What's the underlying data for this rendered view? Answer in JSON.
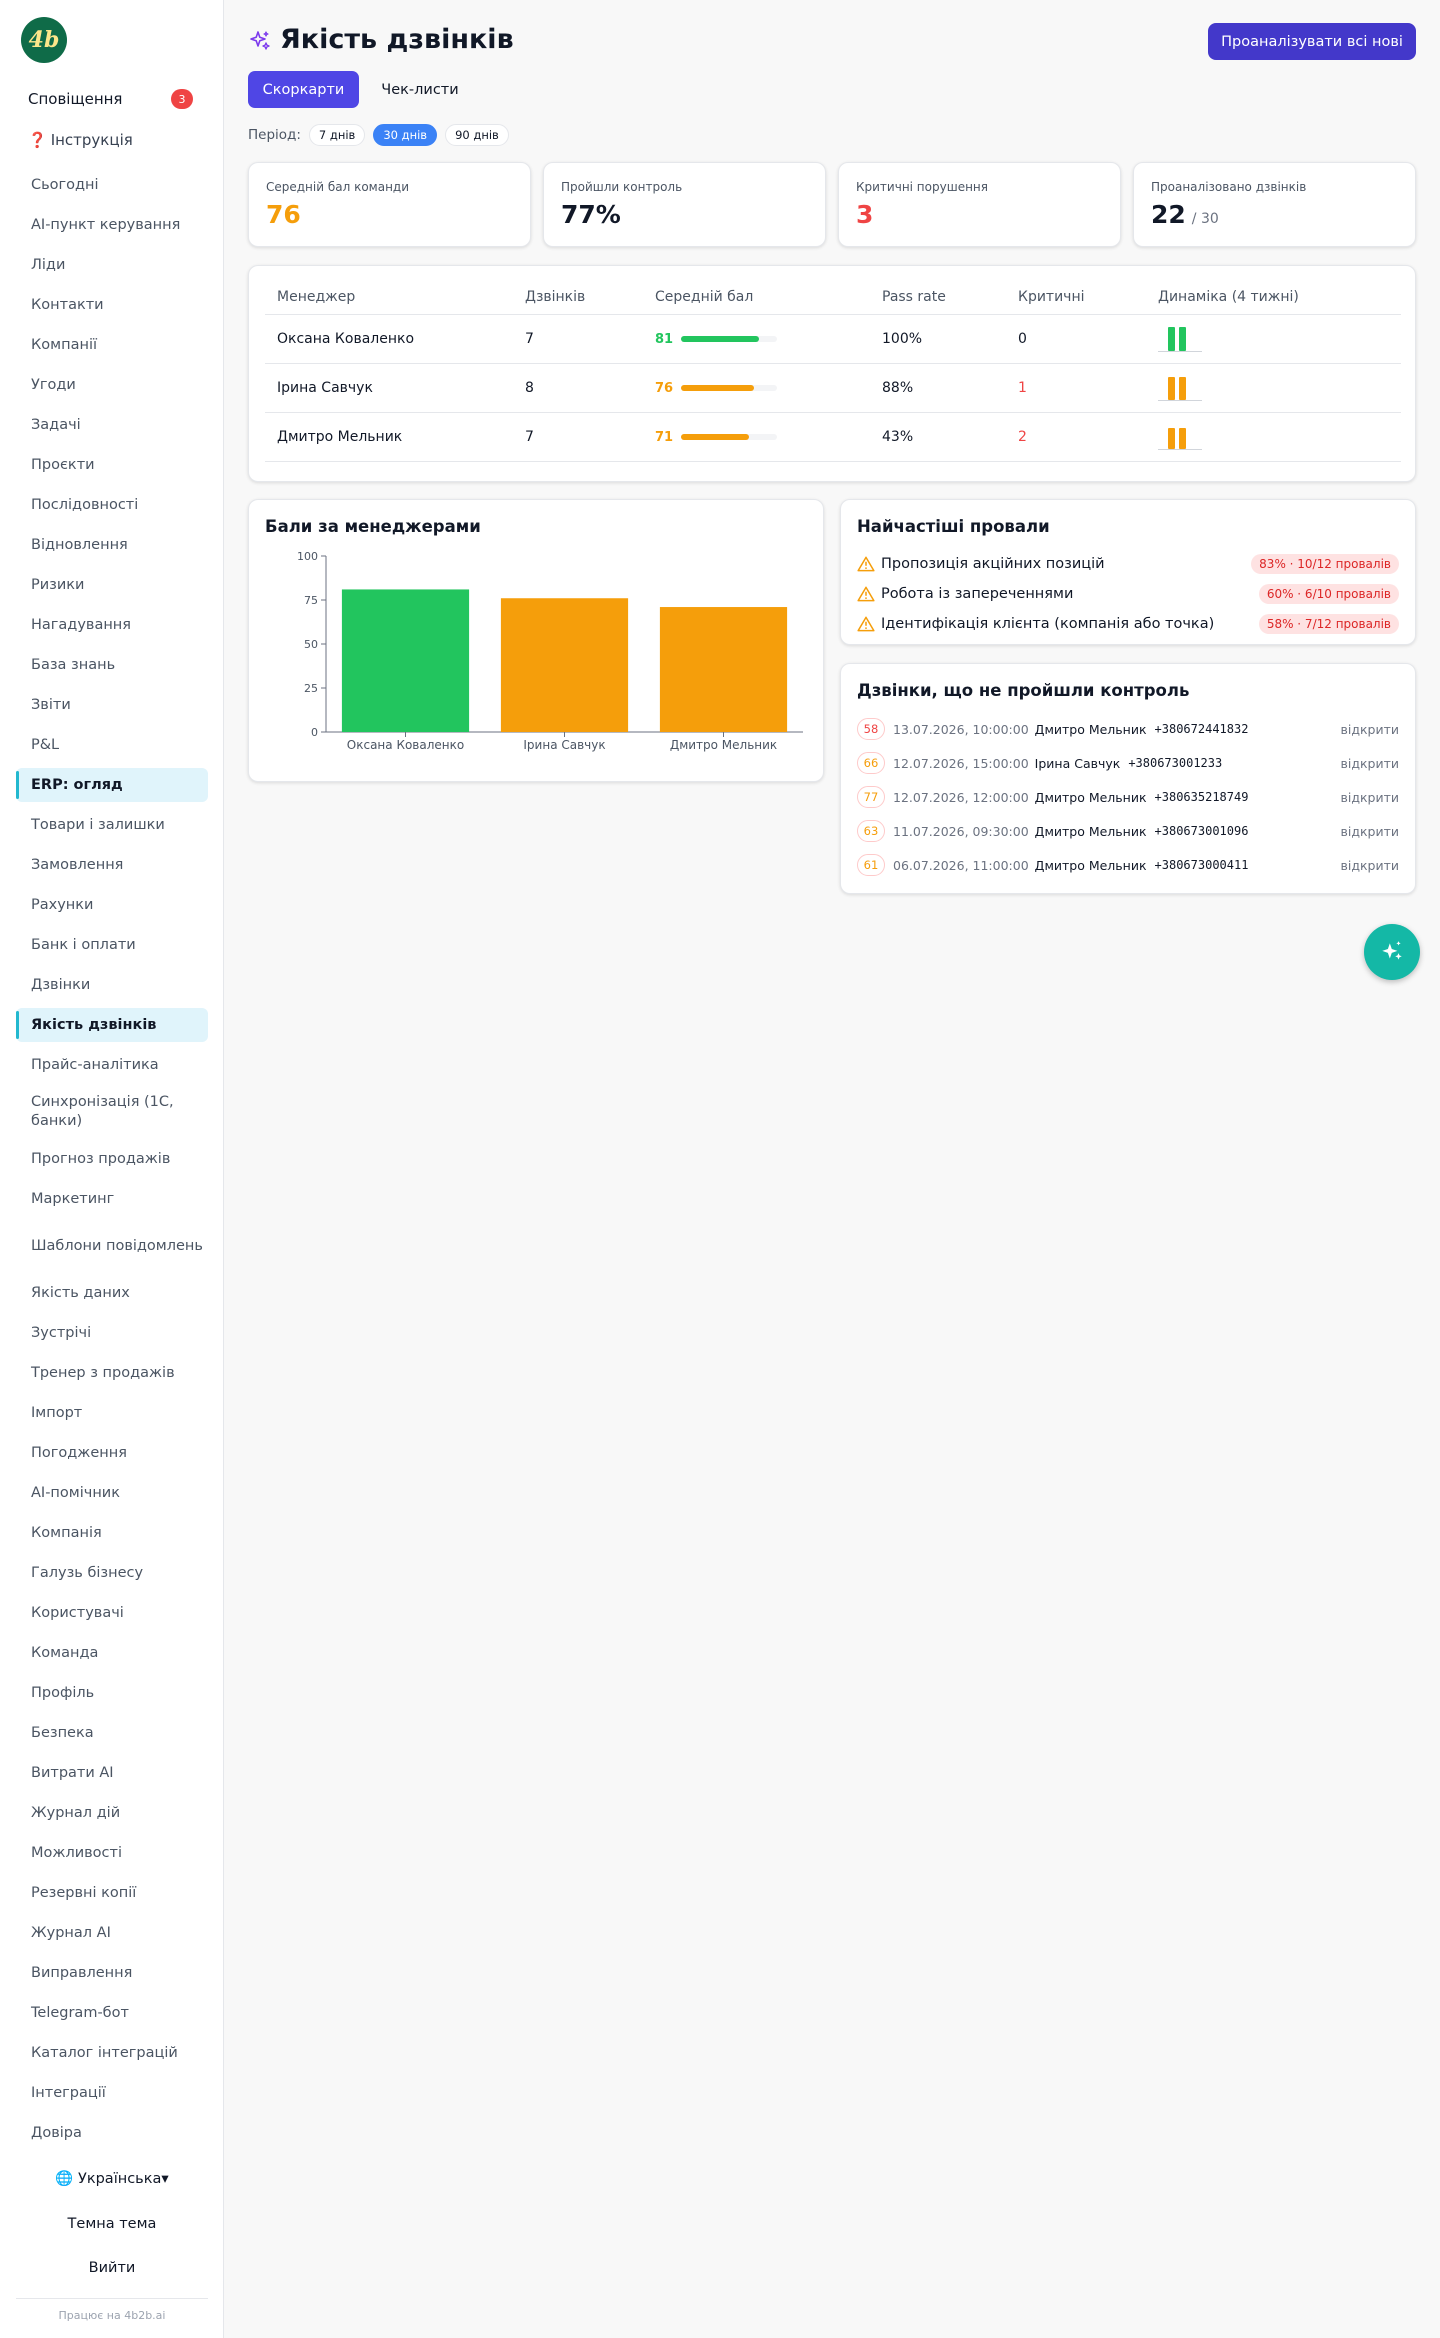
{
  "brand": {
    "logo_text": "4b"
  },
  "sidebar": {
    "notifications_label": "Сповіщення",
    "notifications_count": "3",
    "guide_icon": "❓",
    "guide_label": "Інструкція",
    "items": [
      {
        "label": "Сьогодні"
      },
      {
        "label": "AI-пункт керування"
      },
      {
        "label": "Ліди"
      },
      {
        "label": "Контакти"
      },
      {
        "label": "Компанії"
      },
      {
        "label": "Угоди"
      },
      {
        "label": "Задачі"
      },
      {
        "label": "Проєкти"
      },
      {
        "label": "Послідовності"
      },
      {
        "label": "Відновлення"
      },
      {
        "label": "Ризики"
      },
      {
        "label": "Нагадування"
      },
      {
        "label": "База знань"
      },
      {
        "label": "Звіти"
      },
      {
        "label": "P&L"
      },
      {
        "label": "ERP: огляд",
        "active": true
      },
      {
        "label": "Товари і залишки"
      },
      {
        "label": "Замовлення"
      },
      {
        "label": "Рахунки"
      },
      {
        "label": "Банк і оплати"
      },
      {
        "label": "Дзвінки"
      },
      {
        "label": "Якість дзвінків",
        "active": true
      },
      {
        "label": "Прайс-аналітика"
      },
      {
        "label": "Синхронізація (1С, банки)",
        "tall": true
      },
      {
        "label": "Прогноз продажів"
      },
      {
        "label": "Маркетинг"
      },
      {
        "label": "Шаблони повідомлень",
        "tall": true
      },
      {
        "label": "Якість даних"
      },
      {
        "label": "Зустрічі"
      },
      {
        "label": "Тренер з продажів"
      },
      {
        "label": "Імпорт"
      },
      {
        "label": "Погодження"
      },
      {
        "label": "AI-помічник"
      },
      {
        "label": "Компанія"
      },
      {
        "label": "Галузь бізнесу"
      },
      {
        "label": "Користувачі"
      },
      {
        "label": "Команда"
      },
      {
        "label": "Профіль"
      },
      {
        "label": "Безпека"
      },
      {
        "label": "Витрати AI"
      },
      {
        "label": "Журнал дій"
      },
      {
        "label": "Можливості"
      },
      {
        "label": "Резервні копії"
      },
      {
        "label": "Журнал AI"
      },
      {
        "label": "Виправлення"
      },
      {
        "label": "Telegram-бот"
      },
      {
        "label": "Каталог інтеграцій"
      },
      {
        "label": "Інтеграції"
      },
      {
        "label": "Довіра"
      }
    ],
    "language": "🌐 Українська▾",
    "theme_label": "Темна тема",
    "logout_label": "Вийти",
    "powered_by": "Працює на 4b2b.ai"
  },
  "header": {
    "title": "Якість дзвінків",
    "analyze_button": "Проаналізувати всі нові",
    "tabs": [
      "Скоркарти",
      "Чек-листи"
    ],
    "period_label": "Період:",
    "periods": [
      "7 днів",
      "30 днів",
      "90 днів"
    ],
    "selected_period": "30 днів"
  },
  "kpis": [
    {
      "label": "Середній бал команди",
      "value": "76",
      "color": "#f59e0b"
    },
    {
      "label": "Пройшли контроль",
      "value": "77%",
      "color": "#111827"
    },
    {
      "label": "Критичні порушення",
      "value": "3",
      "color": "#ef4444"
    },
    {
      "label": "Проаналізовано дзвінків",
      "value": "22",
      "sub": "/ 30",
      "color": "#111827"
    }
  ],
  "table": {
    "headers": [
      "Менеджер",
      "Дзвінків",
      "Середній бал",
      "Pass rate",
      "Критичні",
      "Динаміка (4 тижні)"
    ],
    "rows": [
      {
        "manager": "Оксана Коваленко",
        "calls": "7",
        "score": "81",
        "score_fraction": 0.81,
        "color": "#22c55e",
        "pass_rate": "100%",
        "critical": "0",
        "critical_color": "#111827",
        "trend": [
          81,
          81
        ]
      },
      {
        "manager": "Ірина Савчук",
        "calls": "8",
        "score": "76",
        "score_fraction": 0.76,
        "color": "#f59e0b",
        "pass_rate": "88%",
        "critical": "1",
        "critical_color": "#ef4444",
        "trend": [
          76,
          76
        ]
      },
      {
        "manager": "Дмитро Мельник",
        "calls": "7",
        "score": "71",
        "score_fraction": 0.71,
        "color": "#f59e0b",
        "pass_rate": "43%",
        "critical": "2",
        "critical_color": "#ef4444",
        "trend": [
          71,
          71
        ]
      }
    ]
  },
  "chart_section": {
    "title": "Бали за менеджерами"
  },
  "chart_data": {
    "type": "bar",
    "categories": [
      "Оксана Коваленко",
      "Ірина Савчук",
      "Дмитро Мельник"
    ],
    "values": [
      81,
      76,
      71
    ],
    "colors": [
      "#22c55e",
      "#f59e0b",
      "#f59e0b"
    ],
    "yticks": [
      "0",
      "25",
      "50",
      "75",
      "100"
    ],
    "ylim": [
      0,
      100
    ],
    "grid": false
  },
  "failures": {
    "title": "Найчастіші провали",
    "items": [
      {
        "label": "Пропозиція акційних позицій",
        "stat": "83% · 10/12 провалів"
      },
      {
        "label": "Робота із запереченнями",
        "stat": "60% · 6/10 провалів"
      },
      {
        "label": "Ідентифікація клієнта (компанія або точка)",
        "stat": "58% · 7/12 провалів"
      }
    ]
  },
  "failed_calls": {
    "title": "Дзвінки, що не пройшли контроль",
    "open_label": "відкрити",
    "items": [
      {
        "score": "58",
        "color": "#ef4444",
        "date": "13.07.2026, 10:00:00",
        "manager": "Дмитро Мельник",
        "phone": "+380672441832"
      },
      {
        "score": "66",
        "color": "#f59e0b",
        "date": "12.07.2026, 15:00:00",
        "manager": "Ірина Савчук",
        "phone": "+380673001233"
      },
      {
        "score": "77",
        "color": "#f59e0b",
        "date": "12.07.2026, 12:00:00",
        "manager": "Дмитро Мельник",
        "phone": "+380635218749"
      },
      {
        "score": "63",
        "color": "#f59e0b",
        "date": "11.07.2026, 09:30:00",
        "manager": "Дмитро Мельник",
        "phone": "+380673001096"
      },
      {
        "score": "61",
        "color": "#f59e0b",
        "date": "06.07.2026, 11:00:00",
        "manager": "Дмитро Мельник",
        "phone": "+380673000411"
      }
    ]
  },
  "colors": {
    "accent": "#4f46e5",
    "primary_button": "#4338ca",
    "fab": "#14b8a6"
  }
}
